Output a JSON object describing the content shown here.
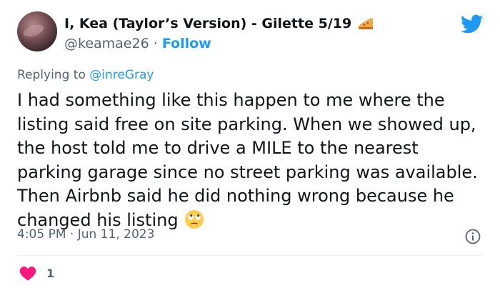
{
  "author": {
    "display_name": "I, Kea (Taylor’s Version) - Gilette 5/19",
    "handle": "@keamae26",
    "separator": "·",
    "follow_label": "Follow"
  },
  "reply": {
    "prefix": "Replying to",
    "target": "@inreGray"
  },
  "tweet": {
    "text": "I had something like this happen to me where the listing said free on site parking. When we showed up, the host told me to drive a MILE to the nearest parking garage since no street parking was available. Then Airbnb said he did nothing wrong because he changed his listing",
    "trailing_emoji": "face-with-rolling-eyes-icon"
  },
  "meta": {
    "time": "4:05 PM",
    "separator": "·",
    "date": "Jun 11, 2023"
  },
  "engagement": {
    "likes": "1"
  },
  "colors": {
    "brand_blue": "#1d9bf0",
    "secondary_text": "#536471",
    "like_red": "#f91880"
  }
}
